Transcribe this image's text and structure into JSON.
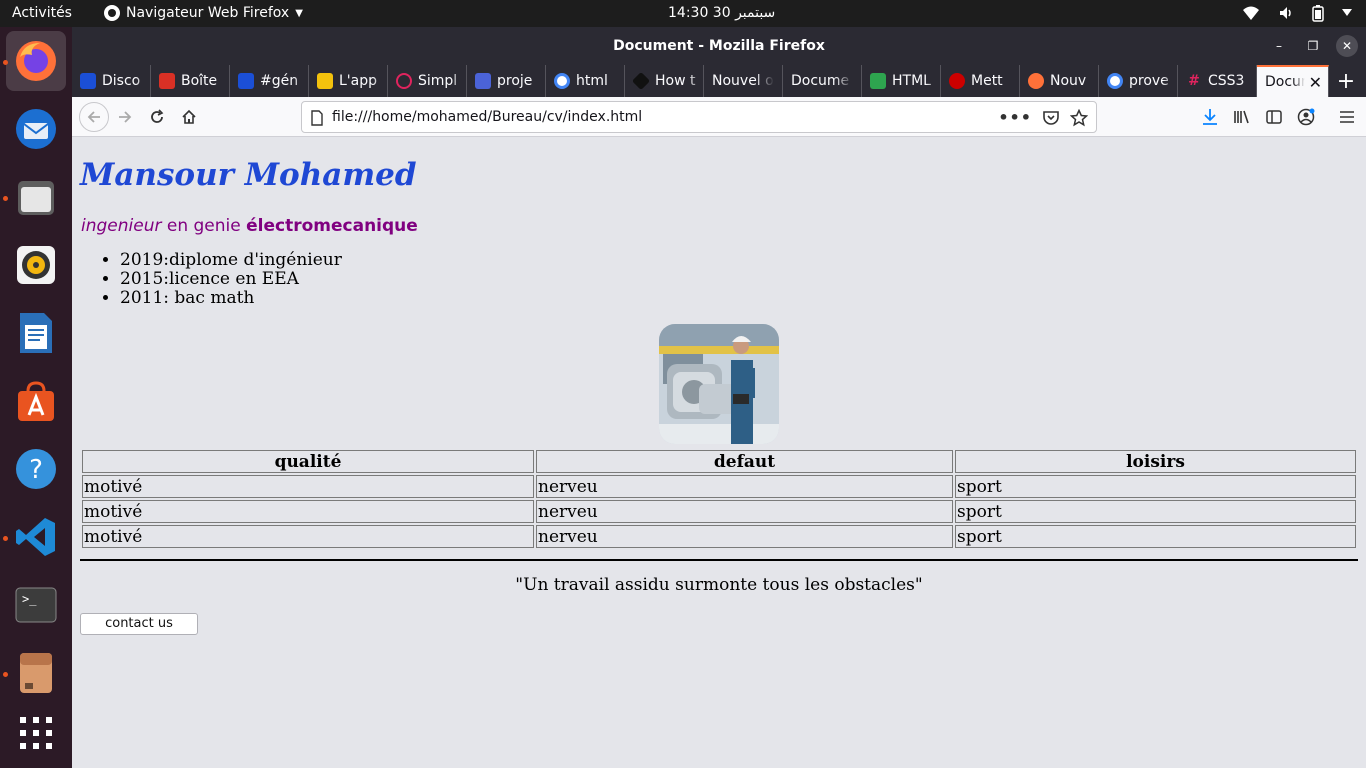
{
  "topbar": {
    "activities": "Activités",
    "app_name": "Navigateur Web Firefox",
    "clock": "14:30  30 سبتمبر"
  },
  "dock": {
    "items": [
      "firefox-icon",
      "thunderbird-icon",
      "files-icon",
      "rhythmbox-icon",
      "libreoffice-writer-icon",
      "ubuntu-software-icon",
      "help-icon",
      "vscode-icon",
      "terminal-icon",
      "archive-icon",
      "show-apps-icon"
    ]
  },
  "window": {
    "title": "Document - Mozilla Firefox"
  },
  "tabs": [
    {
      "label": "Disco",
      "color": "#1b4fd6"
    },
    {
      "label": "Boîte",
      "color": "#d93025"
    },
    {
      "label": "#gén",
      "color": "#1b4fd6"
    },
    {
      "label": "L'app",
      "color": "#f4c20d"
    },
    {
      "label": "Simpl",
      "color": "#e0245e"
    },
    {
      "label": "proje",
      "color": "#4b63d8"
    },
    {
      "label": "html",
      "color": "#4285f4"
    },
    {
      "label": "How t",
      "color": "#111111"
    },
    {
      "label": "Nouvel o",
      "color": ""
    },
    {
      "label": "Docume",
      "color": ""
    },
    {
      "label": "HTML",
      "color": "#2ea44f"
    },
    {
      "label": "Mett",
      "color": "#cc0000"
    },
    {
      "label": "Nouv",
      "color": "#ff7139"
    },
    {
      "label": "prove",
      "color": "#4285f4"
    },
    {
      "label": "CSS3",
      "color": "#e0245e"
    },
    {
      "label": "Docum",
      "color": ""
    }
  ],
  "navbar": {
    "url": "file:///home/mohamed/Bureau/cv/index.html"
  },
  "page": {
    "name": "Mansour Mohamed",
    "subtitle_em": "ingenieur",
    "subtitle_mid": " en genie ",
    "subtitle_bold": "électromecanique",
    "education": [
      "2019:diplome d'ingénieur",
      "2015:licence en EEA",
      "2011: bac math"
    ],
    "table": {
      "headers": [
        "qualité",
        "defaut",
        "loisirs"
      ],
      "rows": [
        [
          "motivé",
          "nerveu",
          "sport"
        ],
        [
          "motivé",
          "nerveu",
          "sport"
        ],
        [
          "motivé",
          "nerveu",
          "sport"
        ]
      ]
    },
    "quote": "\"Un travail assidu surmonte tous les obstacles\"",
    "contact_button": "contact us"
  }
}
